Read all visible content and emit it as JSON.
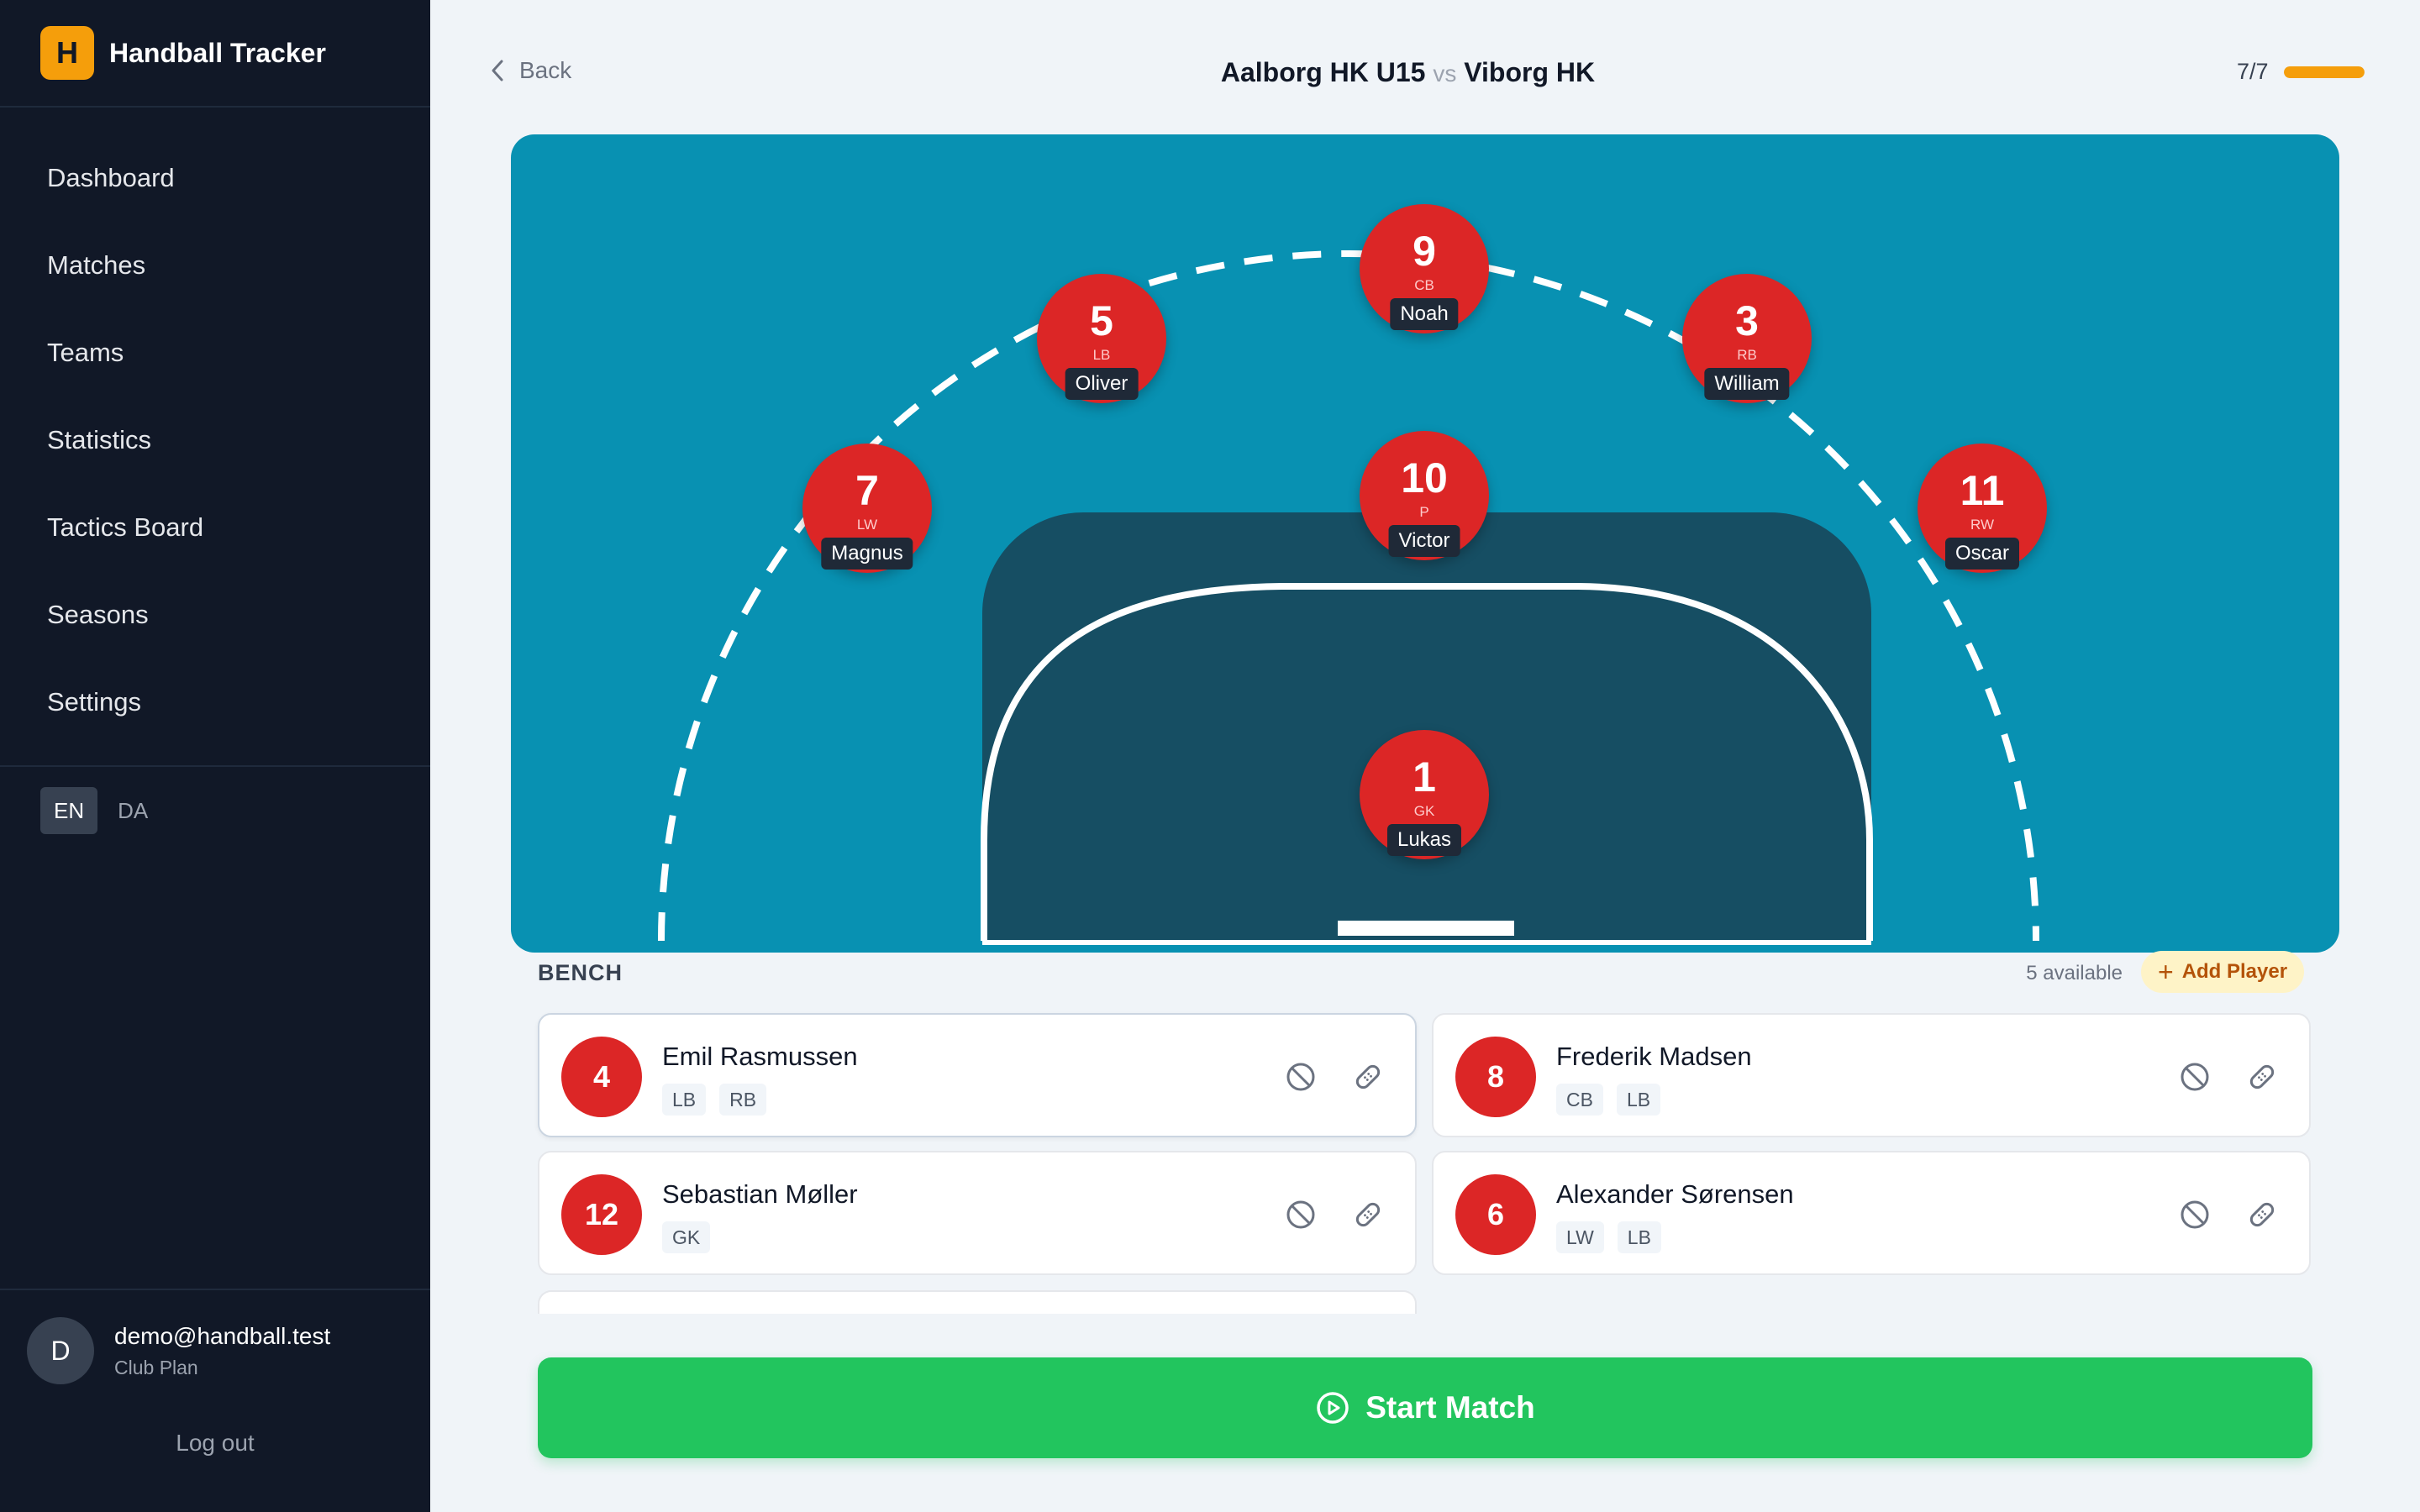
{
  "app": {
    "logo_letter": "H",
    "name": "Handball Tracker"
  },
  "nav": [
    {
      "label": "Dashboard"
    },
    {
      "label": "Matches"
    },
    {
      "label": "Teams"
    },
    {
      "label": "Statistics"
    },
    {
      "label": "Tactics Board"
    },
    {
      "label": "Seasons"
    },
    {
      "label": "Settings"
    }
  ],
  "languages": [
    {
      "code": "EN",
      "active": true
    },
    {
      "code": "DA",
      "active": false
    }
  ],
  "user": {
    "initial": "D",
    "email": "demo@handball.test",
    "plan": "Club Plan",
    "logout_label": "Log out"
  },
  "header": {
    "back_label": "Back",
    "home_team": "Aalborg HK U15",
    "vs_label": "vs",
    "away_team": "Viborg HK",
    "progress_label": "7/7",
    "progress_fraction": 1.0
  },
  "court_players": [
    {
      "number": "9",
      "position": "CB",
      "name": "Noah"
    },
    {
      "number": "5",
      "position": "LB",
      "name": "Oliver"
    },
    {
      "number": "3",
      "position": "RB",
      "name": "William"
    },
    {
      "number": "7",
      "position": "LW",
      "name": "Magnus"
    },
    {
      "number": "10",
      "position": "P",
      "name": "Victor"
    },
    {
      "number": "11",
      "position": "RW",
      "name": "Oscar"
    },
    {
      "number": "1",
      "position": "GK",
      "name": "Lukas"
    }
  ],
  "bench": {
    "title": "BENCH",
    "available_label": "5 available",
    "add_label": "Add Player",
    "players": [
      {
        "number": "4",
        "name": "Emil Rasmussen",
        "positions": [
          "LB",
          "RB"
        ]
      },
      {
        "number": "8",
        "name": "Frederik Madsen",
        "positions": [
          "CB",
          "LB"
        ]
      },
      {
        "number": "12",
        "name": "Sebastian Møller",
        "positions": [
          "GK"
        ]
      },
      {
        "number": "6",
        "name": "Alexander Sørensen",
        "positions": [
          "LW",
          "LB"
        ]
      }
    ]
  },
  "start_label": "Start Match",
  "colors": {
    "sidebar": "#111827",
    "accent": "#f59e0b",
    "court": "#0891b2",
    "goal_area": "#164e63",
    "player": "#dc2626",
    "start": "#22c55e"
  }
}
